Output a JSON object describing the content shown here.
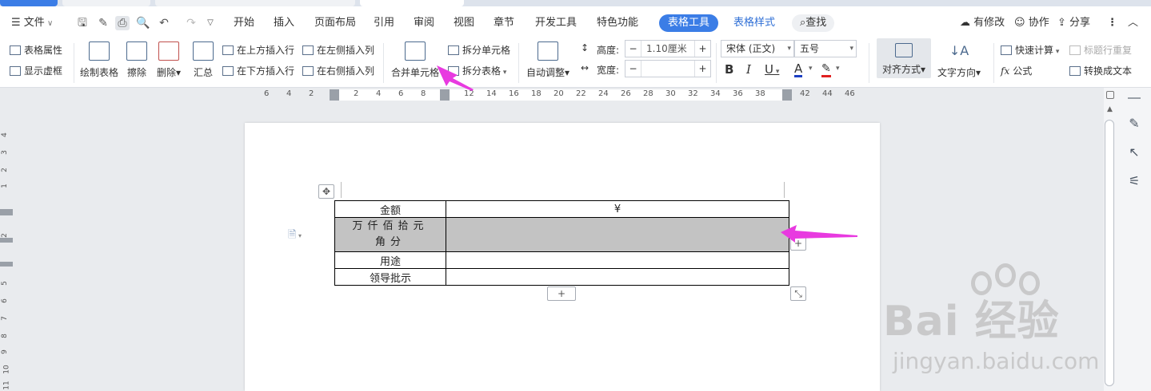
{
  "menubar": {
    "file_label": "文件",
    "tabs": [
      "开始",
      "插入",
      "页面布局",
      "引用",
      "审阅",
      "视图",
      "章节",
      "开发工具",
      "特色功能"
    ],
    "active_tab": "表格工具",
    "table_style_tab": "表格样式",
    "search_label": "查找",
    "modified_label": "有修改",
    "collab_label": "协作",
    "share_label": "分享"
  },
  "ribbon": {
    "table_props": "表格属性",
    "show_gridlines": "显示虚框",
    "draw_table": "绘制表格",
    "erase": "擦除",
    "delete": "删除",
    "summary": "汇总",
    "insert_above": "在上方插入行",
    "insert_below": "在下方插入行",
    "insert_left": "在左侧插入列",
    "insert_right": "在右侧插入列",
    "merge_cells": "合并单元格",
    "split_cells": "拆分单元格",
    "split_table": "拆分表格",
    "auto_fit": "自动调整",
    "height_label": "高度:",
    "height_value": "1.10厘米",
    "width_label": "宽度:",
    "width_value": "",
    "font_name": "宋体 (正文)",
    "font_size": "五号",
    "bold": "B",
    "italic": "I",
    "underline": "U",
    "align": "对齐方式",
    "text_direction": "文字方向",
    "quick_calc": "快速计算",
    "title_repeat": "标题行重复",
    "formula": "公式",
    "to_text": "转换成文本"
  },
  "ruler": {
    "numbers": [
      "6",
      "4",
      "2",
      "2",
      "4",
      "6",
      "8",
      "12",
      "14",
      "16",
      "18",
      "20",
      "22",
      "24",
      "26",
      "28",
      "30",
      "32",
      "34",
      "36",
      "38",
      "42",
      "44",
      "46"
    ]
  },
  "vruler": {
    "numbers": [
      "4",
      "3",
      "2",
      "1",
      "2",
      "5",
      "6",
      "7",
      "8",
      "9",
      "10",
      "11"
    ]
  },
  "table": {
    "rows": [
      {
        "label": "金额",
        "value": "¥"
      },
      {
        "label_line1": "万仟佰拾元",
        "label_line2": "角分",
        "value": ""
      },
      {
        "label": "用途",
        "value": ""
      },
      {
        "label": "领导批示",
        "value": ""
      }
    ]
  },
  "watermark": {
    "main": "Bai 经验",
    "sub": "jingyan.baidu.com"
  },
  "colors": {
    "accent": "#3b7de6",
    "selection": "#c3c3c3",
    "arrow": "#e83ae0"
  }
}
